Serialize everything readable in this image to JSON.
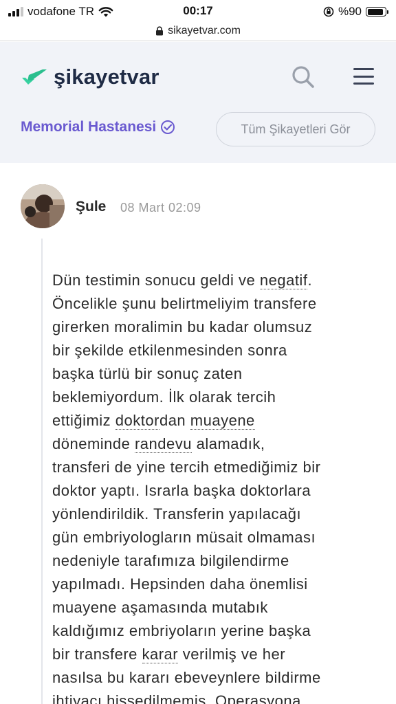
{
  "status_bar": {
    "carrier": "vodafone TR",
    "time": "00:17",
    "battery_percent": "%90",
    "battery_level": 0.9
  },
  "browser": {
    "url": "sikayetvar.com"
  },
  "header": {
    "logo_text": "şikayetvar",
    "brand_name": "Memorial Hastanesi",
    "all_complaints_label": "Tüm Şikayetleri Gör",
    "colors": {
      "brand_accent": "#6a5ad0",
      "logo_green": "#36d1a0",
      "header_bg": "#f1f3f8"
    }
  },
  "complaint": {
    "author": "Şule",
    "date": "08 Mart 02:09",
    "lines": [
      [
        {
          "t": "Dün testimin sonucu geldi ve "
        },
        {
          "t": "negatif",
          "k": true
        },
        {
          "t": "."
        }
      ],
      [
        {
          "t": "Öncelikle şunu belirtmeliyim transfere"
        }
      ],
      [
        {
          "t": "girerken moralimin bu kadar olumsuz"
        }
      ],
      [
        {
          "t": "bir şekilde etkilenmesinden sonra"
        }
      ],
      [
        {
          "t": "başka türlü bir sonuç zaten"
        }
      ],
      [
        {
          "t": "beklemiyordum. İlk olarak tercih"
        }
      ],
      [
        {
          "t": "ettiğimiz "
        },
        {
          "t": "doktor",
          "k": true
        },
        {
          "t": "dan "
        },
        {
          "t": "muayene",
          "k": true
        }
      ],
      [
        {
          "t": "döneminde "
        },
        {
          "t": "randevu",
          "k": true
        },
        {
          "t": " alamadık,"
        }
      ],
      [
        {
          "t": "transferi de yine tercih etmediğimiz bir"
        }
      ],
      [
        {
          "t": "doktor yaptı. Israrla başka doktorlara"
        }
      ],
      [
        {
          "t": "yönlendirildik. Transferin yapılacağı"
        }
      ],
      [
        {
          "t": "gün embriyologların müsait olmaması"
        }
      ],
      [
        {
          "t": "nedeniyle tarafımıza bilgilendirme"
        }
      ],
      [
        {
          "t": "yapılmadı. Hepsinden daha önemlisi"
        }
      ],
      [
        {
          "t": "muayene aşamasında mutabık"
        }
      ],
      [
        {
          "t": "kaldığımız embriyoların yerine başka"
        }
      ],
      [
        {
          "t": "bir transfere "
        },
        {
          "t": "karar",
          "k": true
        },
        {
          "t": " verilmiş ve her"
        }
      ],
      [
        {
          "t": "nasılsa bu kararı ebeveynlere bildirme"
        }
      ],
      [
        {
          "t": "ihtiyacı hissedilmemiş. Operasyona"
        }
      ]
    ]
  }
}
